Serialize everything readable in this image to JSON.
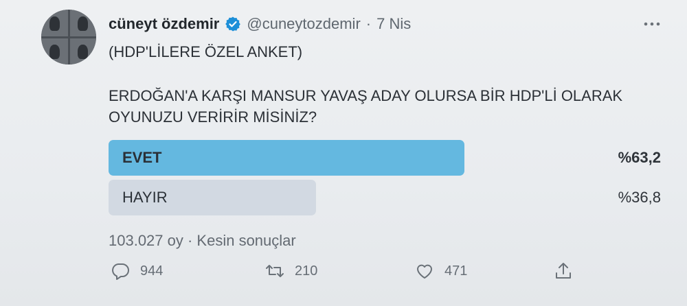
{
  "author": {
    "name": "cüneyt özdemir",
    "handle": "@cuneytozdemir",
    "separator": "·",
    "date": "7 Nis"
  },
  "tweet": {
    "line1": "(HDP'LİLERE ÖZEL ANKET)",
    "line2": "ERDOĞAN'A KARŞI MANSUR YAVAŞ ADAY OLURSA BİR HDP'Lİ OLARAK",
    "line3": "OYUNUZU VERİRİR MİSİNİZ?"
  },
  "poll": {
    "options": [
      {
        "label": "EVET",
        "percent_text": "%63,2",
        "percent": 63.2,
        "winner": true
      },
      {
        "label": "HAYIR",
        "percent_text": "%36,8",
        "percent": 36.8,
        "winner": false
      }
    ],
    "meta": "103.027 oy · Kesin sonuçlar"
  },
  "actions": {
    "reply_count": "944",
    "retweet_count": "210",
    "like_count": "471"
  },
  "colors": {
    "winner_bar": "#64b8e0",
    "loser_bar": "#d2d9e2",
    "verified": "#1d8fd8"
  },
  "icons": [
    "verified-badge-icon",
    "more-icon",
    "reply-icon",
    "retweet-icon",
    "like-icon",
    "share-icon"
  ]
}
